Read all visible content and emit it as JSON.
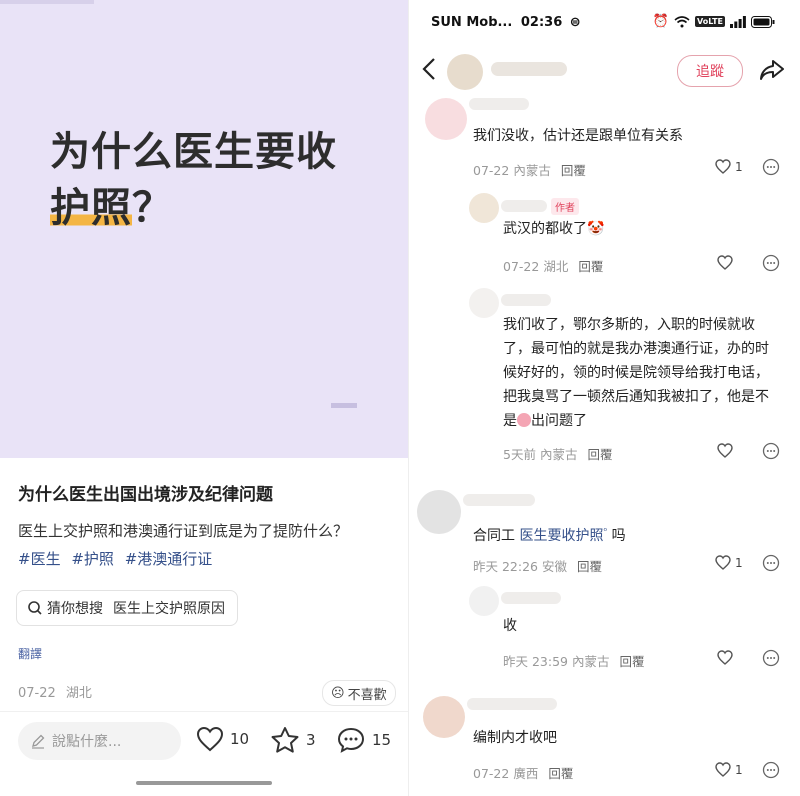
{
  "left": {
    "cover": {
      "title_line1": "为什么医生要收",
      "title_line2_hl": "护照",
      "title_line2_tail": "？"
    },
    "post": {
      "title": "为什么医生出国出境涉及纪律问题",
      "body": "医生上交护照和港澳通行证到底是为了提防什么？",
      "tags": [
        "#医生",
        "#护照",
        "#港澳通行证"
      ],
      "search_prefix": "猜你想搜",
      "search_query": "医生上交护照原因",
      "translate": "翻譯",
      "date": "07-22",
      "location": "湖北",
      "dislike": "不喜歡"
    },
    "bottom": {
      "comment_placeholder": "說點什麼...",
      "likes": "10",
      "stars": "3",
      "comments": "15"
    }
  },
  "right": {
    "status": {
      "carrier": "SUN Mob...",
      "time": "02:36",
      "volte": "VoLTE"
    },
    "nav": {
      "follow": "追蹤"
    },
    "comments": [
      {
        "text": "我们没收，估计还是跟单位有关系",
        "date": "07-22",
        "loc": "內蒙古",
        "reply": "回覆",
        "likes": "1"
      },
      {
        "badge": "作者",
        "text": "武汉的都收了",
        "date": "07-22",
        "loc": "湖北",
        "reply": "回覆",
        "likes": ""
      },
      {
        "lines": [
          "我们收了，鄂尔多斯的，入职的时候就收",
          "了，最可怕的就是我办港澳通行证，办的时",
          "候好好的，领的时候是院领导给我打电话，",
          "把我臭骂了一顿然后通知我被扣了，他是不",
          "是"
        ],
        "tail": "出问题了",
        "date": "5天前",
        "loc": "內蒙古",
        "reply": "回覆",
        "likes": ""
      },
      {
        "prefix": "合同工 ",
        "link": "医生要收护照",
        "suffix": " 吗",
        "date": "昨天 22:26",
        "loc": "安徽",
        "reply": "回覆",
        "likes": "1"
      },
      {
        "text": "收",
        "date": "昨天 23:59",
        "loc": "內蒙古",
        "reply": "回覆",
        "likes": ""
      },
      {
        "text": "编制内才收吧",
        "date": "07-22",
        "loc": "廣西",
        "reply": "回覆",
        "likes": "1"
      }
    ]
  }
}
